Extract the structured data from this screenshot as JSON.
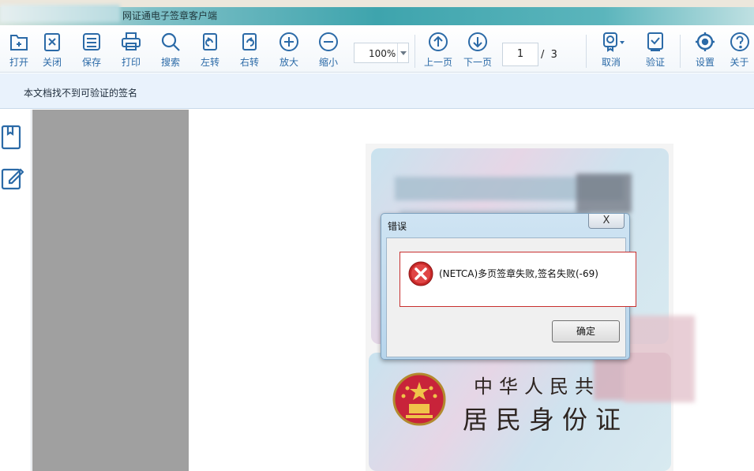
{
  "window": {
    "title": "网证通电子签章客户端"
  },
  "toolbar": {
    "buttons": [
      {
        "label": "打开",
        "icon": "open-file-icon"
      },
      {
        "label": "关闭",
        "icon": "close-doc-icon"
      },
      {
        "label": "保存",
        "icon": "save-icon"
      },
      {
        "label": "打印",
        "icon": "print-icon"
      },
      {
        "label": "搜索",
        "icon": "search-icon"
      },
      {
        "label": "左转",
        "icon": "rotate-left-icon"
      },
      {
        "label": "右转",
        "icon": "rotate-right-icon"
      },
      {
        "label": "放大",
        "icon": "zoom-in-icon"
      },
      {
        "label": "缩小",
        "icon": "zoom-out-icon"
      },
      {
        "label": "上一页",
        "icon": "prev-page-icon"
      },
      {
        "label": "下一页",
        "icon": "next-page-icon"
      },
      {
        "label": "取消",
        "icon": "cancel-seal-icon"
      },
      {
        "label": "验证",
        "icon": "verify-icon"
      },
      {
        "label": "设置",
        "icon": "settings-icon"
      },
      {
        "label": "关于",
        "icon": "about-icon"
      }
    ],
    "zoom_value": "100%",
    "current_page": "1",
    "page_separator": "/",
    "total_pages": "3"
  },
  "infobar": {
    "message": "本文档找不到可验证的签名"
  },
  "sidebar": {
    "icons": [
      "bookmark-icon",
      "annotate-icon"
    ]
  },
  "document": {
    "card_text_line1": "中华人民共",
    "card_text_line2": "居民身份证"
  },
  "dialog": {
    "title": "错误",
    "close_label": "X",
    "message": "(NETCA)多页签章失败,签名失败(-69)",
    "ok_label": "确定",
    "icon": "error-icon"
  },
  "colors": {
    "toolbar_label": "#2b6aa7",
    "icon_stroke": "#2b6aa7",
    "infobar_bg": "#e9f2fc",
    "error_red": "#c62828"
  }
}
